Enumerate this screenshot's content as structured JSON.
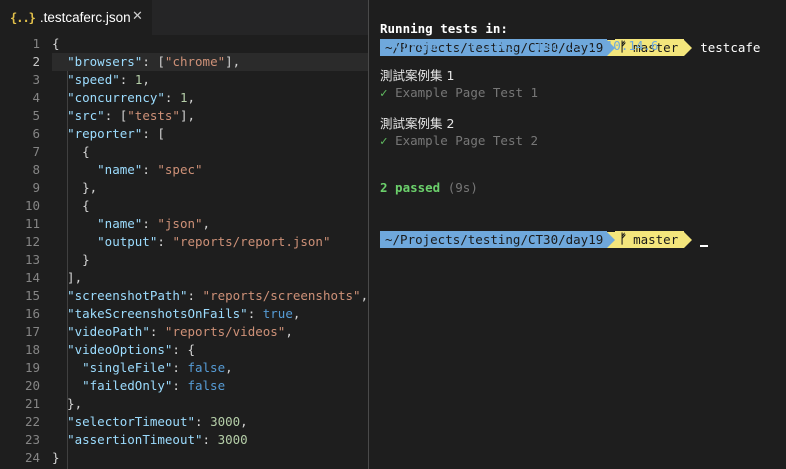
{
  "editor": {
    "tab": {
      "icon_glyph": "{..}",
      "title": ".testcaferc.json",
      "close_glyph": "✕"
    },
    "current_line": 2,
    "lines": [
      {
        "no": "1",
        "tokens": [
          [
            "p",
            "{"
          ]
        ]
      },
      {
        "no": "2",
        "tokens": [
          [
            "p",
            "  "
          ],
          [
            "k",
            "\"browsers\""
          ],
          [
            "p",
            ": "
          ],
          [
            "p",
            "["
          ],
          [
            "s",
            "\"chrome\""
          ],
          [
            "p",
            "],"
          ]
        ]
      },
      {
        "no": "3",
        "tokens": [
          [
            "p",
            "  "
          ],
          [
            "k",
            "\"speed\""
          ],
          [
            "p",
            ": "
          ],
          [
            "n",
            "1"
          ],
          [
            "p",
            ","
          ]
        ]
      },
      {
        "no": "4",
        "tokens": [
          [
            "p",
            "  "
          ],
          [
            "k",
            "\"concurrency\""
          ],
          [
            "p",
            ": "
          ],
          [
            "n",
            "1"
          ],
          [
            "p",
            ","
          ]
        ]
      },
      {
        "no": "5",
        "tokens": [
          [
            "p",
            "  "
          ],
          [
            "k",
            "\"src\""
          ],
          [
            "p",
            ": ["
          ],
          [
            "s",
            "\"tests\""
          ],
          [
            "p",
            "],"
          ]
        ]
      },
      {
        "no": "6",
        "tokens": [
          [
            "p",
            "  "
          ],
          [
            "k",
            "\"reporter\""
          ],
          [
            "p",
            ": ["
          ]
        ]
      },
      {
        "no": "7",
        "tokens": [
          [
            "p",
            "    {"
          ]
        ]
      },
      {
        "no": "8",
        "tokens": [
          [
            "p",
            "      "
          ],
          [
            "k",
            "\"name\""
          ],
          [
            "p",
            ": "
          ],
          [
            "s",
            "\"spec\""
          ]
        ]
      },
      {
        "no": "9",
        "tokens": [
          [
            "p",
            "    },"
          ]
        ]
      },
      {
        "no": "10",
        "tokens": [
          [
            "p",
            "    {"
          ]
        ]
      },
      {
        "no": "11",
        "tokens": [
          [
            "p",
            "      "
          ],
          [
            "k",
            "\"name\""
          ],
          [
            "p",
            ": "
          ],
          [
            "s",
            "\"json\""
          ],
          [
            "p",
            ","
          ]
        ]
      },
      {
        "no": "12",
        "tokens": [
          [
            "p",
            "      "
          ],
          [
            "k",
            "\"output\""
          ],
          [
            "p",
            ": "
          ],
          [
            "s",
            "\"reports/report.json\""
          ]
        ]
      },
      {
        "no": "13",
        "tokens": [
          [
            "p",
            "    }"
          ]
        ]
      },
      {
        "no": "14",
        "tokens": [
          [
            "p",
            "  ],"
          ]
        ]
      },
      {
        "no": "15",
        "tokens": [
          [
            "p",
            "  "
          ],
          [
            "k",
            "\"screenshotPath\""
          ],
          [
            "p",
            ": "
          ],
          [
            "s",
            "\"reports/screenshots\""
          ],
          [
            "p",
            ","
          ]
        ]
      },
      {
        "no": "16",
        "tokens": [
          [
            "p",
            "  "
          ],
          [
            "k",
            "\"takeScreenshotsOnFails\""
          ],
          [
            "p",
            ": "
          ],
          [
            "b",
            "true"
          ],
          [
            "p",
            ","
          ]
        ]
      },
      {
        "no": "17",
        "tokens": [
          [
            "p",
            "  "
          ],
          [
            "k",
            "\"videoPath\""
          ],
          [
            "p",
            ": "
          ],
          [
            "s",
            "\"reports/videos\""
          ],
          [
            "p",
            ","
          ]
        ]
      },
      {
        "no": "18",
        "tokens": [
          [
            "p",
            "  "
          ],
          [
            "k",
            "\"videoOptions\""
          ],
          [
            "p",
            ": {"
          ]
        ]
      },
      {
        "no": "19",
        "tokens": [
          [
            "p",
            "    "
          ],
          [
            "k",
            "\"singleFile\""
          ],
          [
            "p",
            ": "
          ],
          [
            "b",
            "false"
          ],
          [
            "p",
            ","
          ]
        ]
      },
      {
        "no": "20",
        "tokens": [
          [
            "p",
            "    "
          ],
          [
            "k",
            "\"failedOnly\""
          ],
          [
            "p",
            ": "
          ],
          [
            "b",
            "false"
          ]
        ]
      },
      {
        "no": "21",
        "tokens": [
          [
            "p",
            "  },"
          ]
        ]
      },
      {
        "no": "22",
        "tokens": [
          [
            "p",
            "  "
          ],
          [
            "k",
            "\"selectorTimeout\""
          ],
          [
            "p",
            ": "
          ],
          [
            "n",
            "3000"
          ],
          [
            "p",
            ","
          ]
        ]
      },
      {
        "no": "23",
        "tokens": [
          [
            "p",
            "  "
          ],
          [
            "k",
            "\"assertionTimeout\""
          ],
          [
            "p",
            ": "
          ],
          [
            "n",
            "3000"
          ]
        ]
      },
      {
        "no": "24",
        "tokens": [
          [
            "p",
            "}"
          ]
        ]
      }
    ]
  },
  "terminal": {
    "prompt1": {
      "path": "~/Projects/testing/CT30/day19",
      "branch_glyph": "ᚠ",
      "branch": "master",
      "command": "testcafe"
    },
    "running_label": "Running tests in:",
    "browser_line": "- Chrome 77.0.3865 / Mac OS X 10.14.6",
    "fixture1": "測試案例集 1",
    "test1_check": "✓",
    "test1": "Example Page Test 1",
    "fixture2": "測試案例集 2",
    "test2_check": "✓",
    "test2": "Example Page Test 2",
    "passed": "2 passed",
    "duration": "(9s)",
    "prompt2": {
      "path": "~/Projects/testing/CT30/day19",
      "branch_glyph": "ᚠ",
      "branch": "master"
    }
  },
  "colors": {
    "editor_bg": "#1e1e1e",
    "key": "#9cdcfe",
    "string": "#ce9178",
    "number": "#b5cea8",
    "boolean": "#569cd6",
    "prompt_path_bg": "#6fa8dc",
    "prompt_branch_bg": "#f4e67c",
    "passed_green": "#6bd06b"
  }
}
